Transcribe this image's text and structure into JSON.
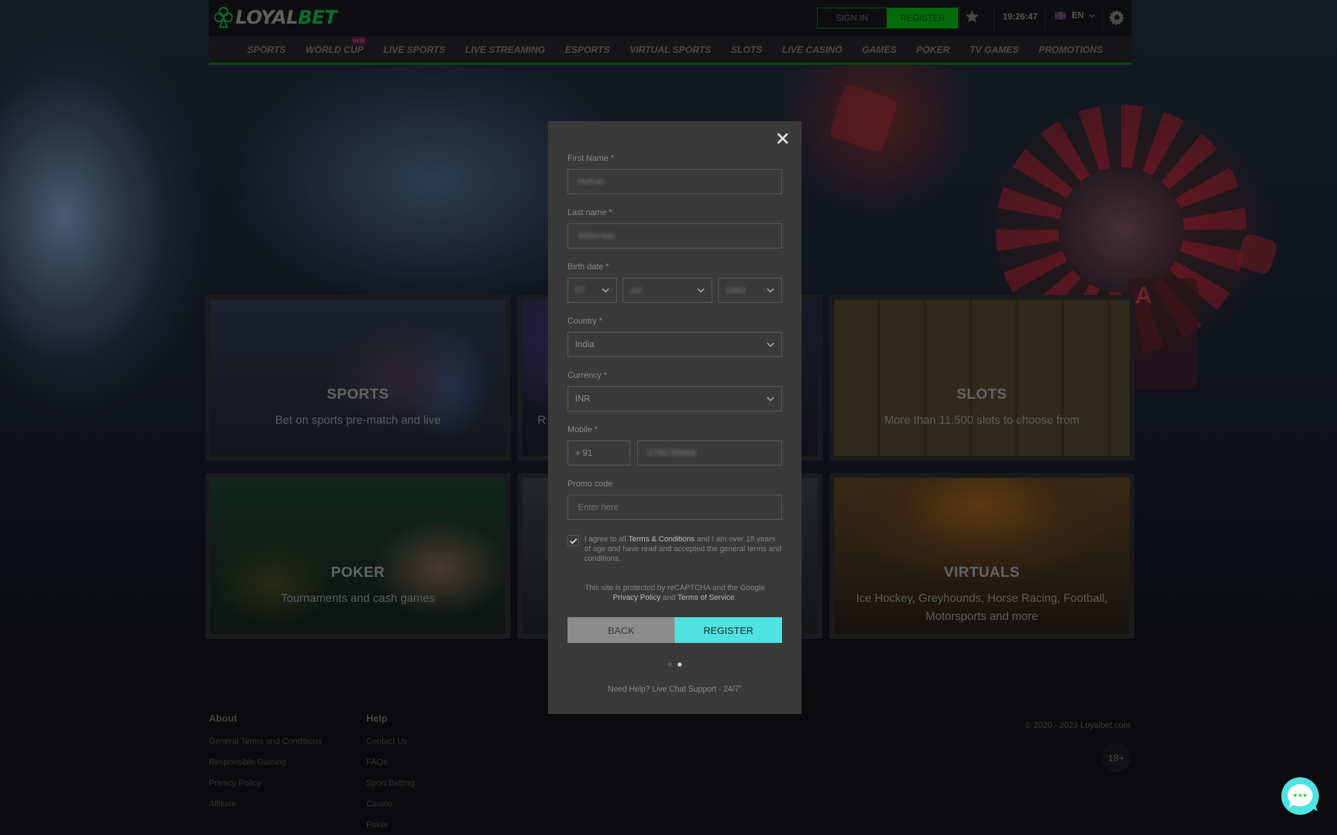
{
  "brand": {
    "name_part1": "LOYAL",
    "name_part2": "BET",
    "accent_color": "#0c6d2e"
  },
  "header": {
    "signin_label": "SIGN IN",
    "register_label": "REGISTER",
    "time": "19:26:47",
    "language": "EN",
    "icons": [
      "favorites-star-icon",
      "uk-flag-icon",
      "chevron-down-icon",
      "settings-gear-icon"
    ]
  },
  "nav": {
    "items": [
      {
        "label": "SPORTS"
      },
      {
        "label": "WORLD CUP",
        "badge": "NEW"
      },
      {
        "label": "LIVE SPORTS"
      },
      {
        "label": "LIVE STREAMING"
      },
      {
        "label": "ESPORTS"
      },
      {
        "label": "VIRTUAL SPORTS"
      },
      {
        "label": "SLOTS"
      },
      {
        "label": "LIVE CASINO"
      },
      {
        "label": "GAMES"
      },
      {
        "label": "POKER"
      },
      {
        "label": "TV GAMES"
      },
      {
        "label": "PROMOTIONS"
      }
    ]
  },
  "tiles": [
    {
      "title": "SPORTS",
      "subtitle": "Bet on sports pre-match and live"
    },
    {
      "title": "",
      "subtitle": "R"
    },
    {
      "title": "SLOTS",
      "subtitle": "More than 11.500 slots to choose from"
    },
    {
      "title": "POKER",
      "subtitle": "Tournaments and cash games"
    },
    {
      "title": "",
      "subtitle": ""
    },
    {
      "title": "VIRTUALS",
      "subtitle": "Ice Hockey, Greyhounds, Horse Racing, Football, Motorsports and more"
    }
  ],
  "modal": {
    "close_icon": "close-x-icon",
    "first_name": {
      "label": "First Name *",
      "value": "Hafrah"
    },
    "last_name": {
      "label": "Last name *",
      "value": "Sirbentas"
    },
    "birth_date": {
      "label": "Birth date *",
      "day": "07",
      "month": "Jul",
      "year": "1993"
    },
    "country": {
      "label": "Country *",
      "value": "India"
    },
    "currency": {
      "label": "Currency *",
      "value": "INR"
    },
    "mobile": {
      "label": "Mobile *",
      "prefix": "+ 91",
      "number": "0789789868"
    },
    "promo": {
      "label": "Promo code",
      "placeholder": "Enter here"
    },
    "consent": {
      "checked": true,
      "text_before": "I agree to all ",
      "link": "Terms & Conditions",
      "text_after": " and I am over 18 years of age and have read and accepted the general terms and conditions."
    },
    "recaptcha": {
      "line1": "This site is protected by reCAPTCHA and the Google",
      "privacy_link": "Privacy Policy",
      "and": " and ",
      "tos_link": "Terms of Service",
      "period": "."
    },
    "back_label": "BACK",
    "register_label": "REGISTER",
    "register_color": "#4ee2e2",
    "steps": {
      "total": 2,
      "current": 2
    },
    "help_text": "Need Help? Live Chat Support - 24/7\""
  },
  "footer": {
    "about": {
      "heading": "About",
      "links": [
        "General Terms and Conditions",
        "Responsible Gaming",
        "Privacy Policy",
        "Affiliate"
      ]
    },
    "help": {
      "heading": "Help",
      "links": [
        "Contact Us",
        "FAQs",
        "Sport Betting",
        "Casino",
        "Poker"
      ]
    },
    "copyright": "© 2020 - 2023 Loyalbet.com",
    "age_badge": "18+",
    "chat_icon": "live-chat-bubble-icon"
  }
}
